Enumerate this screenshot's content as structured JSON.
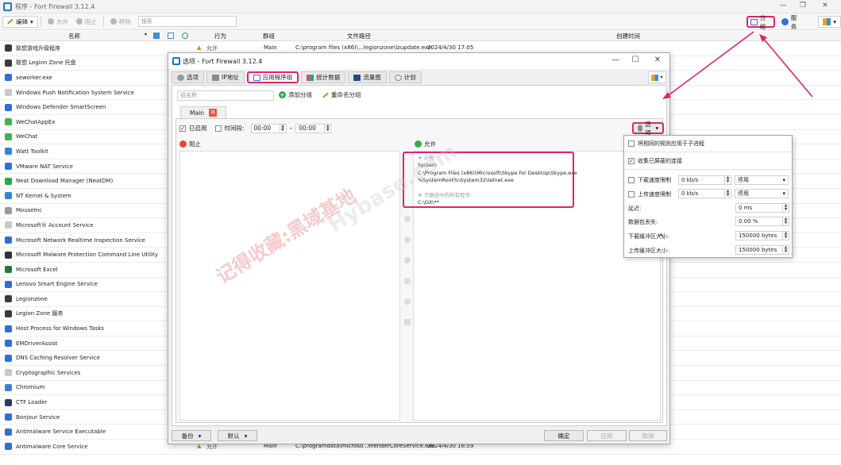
{
  "window": {
    "title": "程序 - Fort Firewall 3.12.4"
  },
  "toolbar": {
    "edit": "编辑",
    "allow": "允许",
    "block": "阻止",
    "remove": "移除",
    "search_placeholder": "搜索",
    "group": "分组",
    "services": "服务"
  },
  "list": {
    "columns": {
      "name": "名称",
      "action": "行为",
      "group": "群组",
      "path": "文件路径",
      "created": "创建时间"
    },
    "top_row": {
      "action": "允许",
      "group": "Main",
      "path": "C:\\program files (x86)\\...legionzone\\lzupdate.exe",
      "created": "2024/4/30 17:05"
    },
    "bottom_row": {
      "action": "允许",
      "group": "Main",
      "path": "C:\\programdata\\microso...efenderCoreService.exe",
      "created": "2024/4/30 16:59"
    },
    "programs": [
      {
        "name": "联想游戏升级程序",
        "color": "#3a3a3a"
      },
      {
        "name": "联想 Legion Zone 托盘",
        "color": "#3a3a3a"
      },
      {
        "name": "seworker.exe",
        "color": "#2f6fd6"
      },
      {
        "name": "Windows Push Notification System Service",
        "color": "#c9c9c9"
      },
      {
        "name": "Windows Defender SmartScreen",
        "color": "#2f6fd6"
      },
      {
        "name": "WeChatAppEx",
        "color": "#3cb44a"
      },
      {
        "name": "WeChat",
        "color": "#3cb44a"
      },
      {
        "name": "Watt Toolkit",
        "color": "#2d86d6"
      },
      {
        "name": "VMware NAT Service",
        "color": "#2f6fd6"
      },
      {
        "name": "Neat Download Manager (NeatDM)",
        "color": "#2aa84a"
      },
      {
        "name": "NT Kernel & System",
        "color": "#2d86d6"
      },
      {
        "name": "MouseInc",
        "color": "#9a9a9a"
      },
      {
        "name": "Microsoft® Account Service",
        "color": "#c9c9c9"
      },
      {
        "name": "Microsoft Network Realtime Inspection Service",
        "color": "#2f6fd6"
      },
      {
        "name": "Microsoft Malware Protection Command Line Utility",
        "color": "#333333"
      },
      {
        "name": "Microsoft Excel",
        "color": "#1f7a3a"
      },
      {
        "name": "Lenovo Smart Engine Service",
        "color": "#2f6fd6"
      },
      {
        "name": "Legionzone",
        "color": "#3a3a3a"
      },
      {
        "name": "Legion Zone 服务",
        "color": "#3a3a3a"
      },
      {
        "name": "Host Process for Windows Tasks",
        "color": "#2f6fd6"
      },
      {
        "name": "EMDriverAssist",
        "color": "#2f6fd6"
      },
      {
        "name": "DNS Caching Resolver Service",
        "color": "#2f6fd6"
      },
      {
        "name": "Cryptographic Services",
        "color": "#c9c9c9"
      },
      {
        "name": "Chromium",
        "color": "#3b82d6"
      },
      {
        "name": "CTF Loader",
        "color": "#2a3a6a"
      },
      {
        "name": "Bonjour Service",
        "color": "#2f6fd6"
      },
      {
        "name": "Antimalware Service Executable",
        "color": "#2f6fd6"
      },
      {
        "name": "Antimalware Core Service",
        "color": "#2f6fd6"
      }
    ]
  },
  "dialog": {
    "title": "选项 - Fort Firewall 3.12.4",
    "tabs": [
      {
        "label": "选项",
        "color": "#9a9a9a"
      },
      {
        "label": "IP地址",
        "color": "#8a8a8a"
      },
      {
        "label": "应用程序组",
        "color": "#2f6fd6"
      },
      {
        "label": "统计数据",
        "color": "#d9534f"
      },
      {
        "label": "流量图",
        "color": "#2a4a7a"
      },
      {
        "label": "计划",
        "color": "#8a8a8a"
      }
    ],
    "group_name_placeholder": "组名称",
    "add_group": "添加分组",
    "rename_group": "重命名分组",
    "group_tab": "Main",
    "enabled": "已启用",
    "period": "时间段:",
    "time_from": "00:00",
    "time_to": "00:00",
    "time_dash": "–",
    "options_btn": "选项",
    "block": "阻止",
    "allow": "允许",
    "allow_example": {
      "c1": "# 示例:",
      "l1": "System",
      "l2": "C:\\Program Files (x86)\\Microsoft\\Skype for Desktop\\Skype.exe",
      "l3": "%SystemRoot%\\System32\\telnet.exe",
      "c2": "# 子路径中的所有程序:",
      "l4": "C:\\Git\\**"
    },
    "footer": {
      "backup": "备份",
      "default": "默认",
      "ok": "确定",
      "apply": "应用",
      "cancel": "取消"
    }
  },
  "menu": {
    "apply_child": "将相同的规则应用于子进程",
    "log_blocked": "收集已屏蔽的连接",
    "dl_limit": "下载速度限制",
    "dl_value": "0 kb/s",
    "dl_mode": "停用",
    "ul_limit": "上传速度限制",
    "ul_value": "0 kb/s",
    "ul_mode": "停用",
    "latency": "延迟:",
    "latency_value": "0 ms",
    "loss": "数据包丢失:",
    "loss_value": "0.00 %",
    "dl_buffer": "下载缓冲区大小:",
    "dl_buffer_value": "150000 bytes",
    "ul_buffer": "上传缓冲区大小:",
    "ul_buffer_value": "150000 bytes"
  },
  "watermark": {
    "line1": "记得收藏:黑域基地",
    "line2": "Hybase.com"
  }
}
